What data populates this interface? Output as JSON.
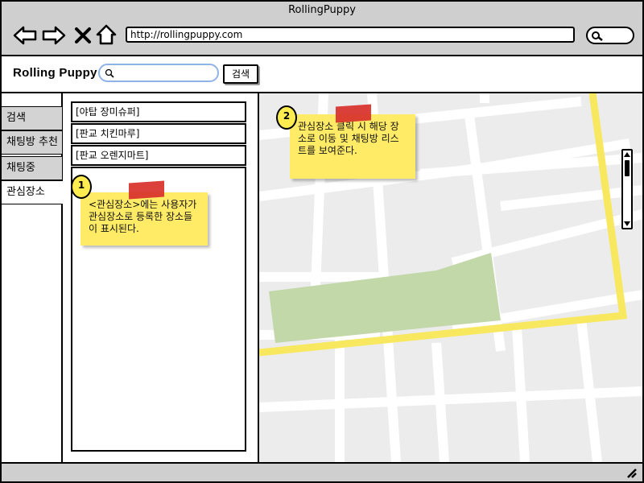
{
  "browser": {
    "title": "RollingPuppy",
    "url": "http://rollingpuppy.com"
  },
  "app": {
    "brand": "Rolling Puppy",
    "search_placeholder": "",
    "search_button": "검색"
  },
  "nav": {
    "tabs": [
      "검색",
      "채팅방 추천",
      "채팅중",
      "관심장소"
    ],
    "active": "관심장소"
  },
  "favorites": {
    "items": [
      "[야탑 장미슈퍼]",
      "[판교 치킨마루]",
      "[판교 오렌지마트]"
    ]
  },
  "notes": [
    {
      "number": "1",
      "text": "<관심장소>에는 사용자가 관심장소로 등록한 장소들이 표시된다."
    },
    {
      "number": "2",
      "text": "관심장소 클릭 시 해당 장소로 이동 및 채팅방 리스트를 보여준다."
    }
  ],
  "icons": [
    "back-arrow-icon",
    "forward-arrow-icon",
    "close-icon",
    "home-icon",
    "search-icon",
    "resize-grip-icon"
  ],
  "colors": {
    "chrome": "#cfcfcf",
    "sticky": "#ffeb66",
    "tape": "#d8302a",
    "map_road": "#ffffff",
    "map_highway": "#f8e860",
    "map_park": "#c2d8a8"
  }
}
